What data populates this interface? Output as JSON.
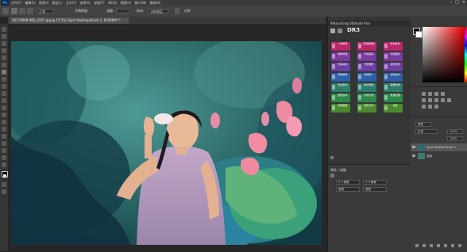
{
  "menubar": {
    "logo": "Ps",
    "items": [
      "文件(F)",
      "编辑(E)",
      "图像(I)",
      "图层(L)",
      "文字(Y)",
      "选择(S)",
      "滤镜(T)",
      "3D(D)",
      "视图(V)",
      "窗口(W)",
      "帮助(H)"
    ],
    "minimize": "–",
    "maximize": "□",
    "close": "✕"
  },
  "optbar": {
    "mode_value": "正常",
    "opacity_label": "不透明度:",
    "flow_label": "流量:",
    "sample_label": "样本:",
    "sample_value": "当前图层",
    "align_label": "对齐"
  },
  "document": {
    "tab_title": "20170608 IMG_0307.jpg @ 12.5% (Spot Healing Brush 1, RGB/8#) *",
    "tab_close": "×"
  },
  "plugin_panel": {
    "title": "Retouching Ultimate Plus",
    "logo": "DR3",
    "buttons": [
      {
        "label": "人像磨皮",
        "color": "#b8276a"
      },
      {
        "label": "高低频磨皮",
        "color": "#b8276a"
      },
      {
        "label": "肤色修复",
        "color": "#b8276a"
      },
      {
        "label": "眼睛增强",
        "color": "#7a3a9e"
      },
      {
        "label": "牙齿美白",
        "color": "#7a3a9e"
      },
      {
        "label": "去除瑕疵",
        "color": "#7a3a9e"
      },
      {
        "label": "加深减淡",
        "color": "#6b3fa0"
      },
      {
        "label": "光影塑形",
        "color": "#6b3fa0"
      },
      {
        "label": "液化调整",
        "color": "#6b3fa0"
      },
      {
        "label": "皮肤质感",
        "color": "#2e5fa8"
      },
      {
        "label": "色调统一",
        "color": "#2e5fa8"
      },
      {
        "label": "去除油光",
        "color": "#2e5fa8"
      },
      {
        "label": "锐化输出",
        "color": "#2f7d6b"
      },
      {
        "label": "胶片颗粒",
        "color": "#2f7d6b"
      },
      {
        "label": "暗角效果",
        "color": "#2f7d6b"
      },
      {
        "label": "图层合并",
        "color": "#2e8a4a"
      },
      {
        "label": "动作记录",
        "color": "#2e8a4a"
      },
      {
        "label": "批量处理",
        "color": "#2e8a4a"
      },
      {
        "label": "清除图层",
        "color": "#4a8a2e"
      },
      {
        "label": "保存文件",
        "color": "#4a8a2e"
      },
      {
        "label": "设置",
        "color": "#4a8a2e"
      }
    ]
  },
  "lower_panel": {
    "title": "属性 / 调整",
    "field1": "0.0 像素",
    "field2": "0.0 像素",
    "field3": "像素",
    "field4": "像素"
  },
  "layers": {
    "kind_label": "类型",
    "blend_mode": "正常",
    "opacity": "100%",
    "fill": "100%",
    "rows": [
      {
        "name": "Spot Healing Brush 1"
      },
      {
        "name": "背景"
      }
    ]
  },
  "colors": {
    "accent": "#31a8ff"
  }
}
